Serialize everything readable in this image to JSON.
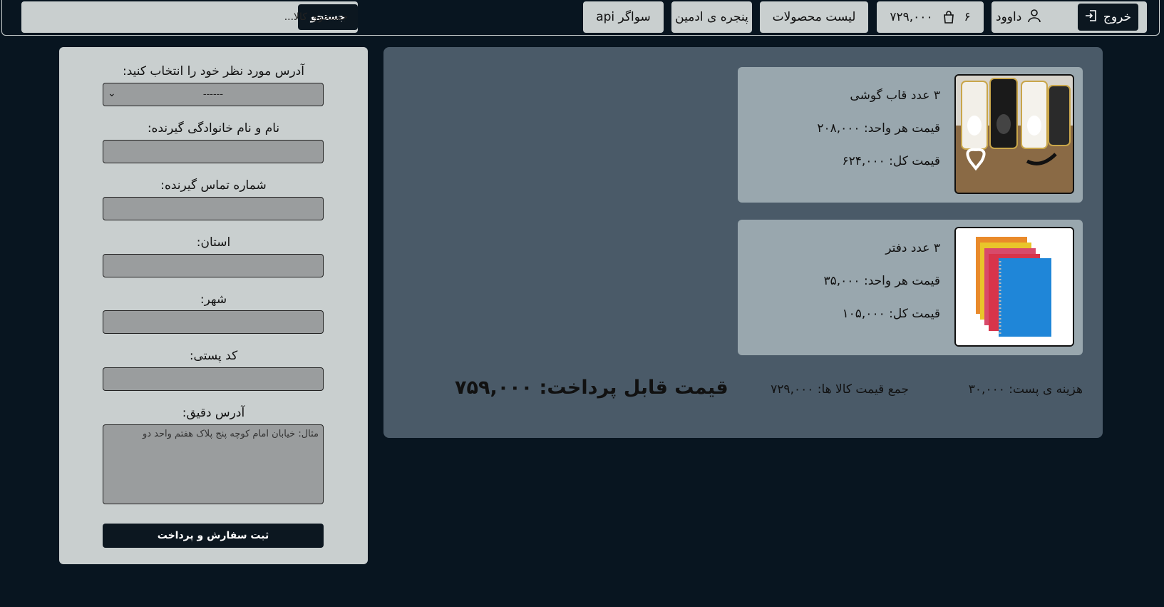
{
  "navbar": {
    "search_placeholder": "جستجوی کالا...",
    "search_button": "جستجو",
    "api_link": "سواگر api",
    "admin_link": "پنجره ی ادمین",
    "products_link": "لیست محصولات",
    "cart_total": "۷۲۹,۰۰۰",
    "cart_count": "۶",
    "logout_label": "خروج",
    "user_name": "داوود"
  },
  "form": {
    "address_label": "آدرس مورد نظر خود را انتخاب کنید:",
    "address_selected": "------",
    "receiver_name_label": "نام و نام خانوادگی گیرنده:",
    "receiver_phone_label": "شماره تماس گیرنده:",
    "province_label": "استان:",
    "city_label": "شهر:",
    "postal_code_label": "کد پستی:",
    "exact_address_label": "آدرس دقیق:",
    "exact_address_placeholder": "مثال: خیابان امام کوچه پنج پلاک هفتم واحد دو",
    "submit_label": "ثبت سفارش و پرداخت"
  },
  "cart": {
    "items": [
      {
        "title": "۳ عدد قاب گوشی",
        "unit_price": "قیمت هر واحد: ۲۰۸,۰۰۰",
        "total_price": "قیمت کل: ۶۲۴,۰۰۰"
      },
      {
        "title": "۳ عدد دفتر",
        "unit_price": "قیمت هر واحد: ۳۵,۰۰۰",
        "total_price": "قیمت کل: ۱۰۵,۰۰۰"
      }
    ],
    "shipping": "هزینه ی پست: ۳۰,۰۰۰",
    "items_sum": "جمع قیمت کالا ها: ۷۲۹,۰۰۰",
    "payable": "قیمت قابل پرداخت: ۷۵۹,۰۰۰"
  }
}
